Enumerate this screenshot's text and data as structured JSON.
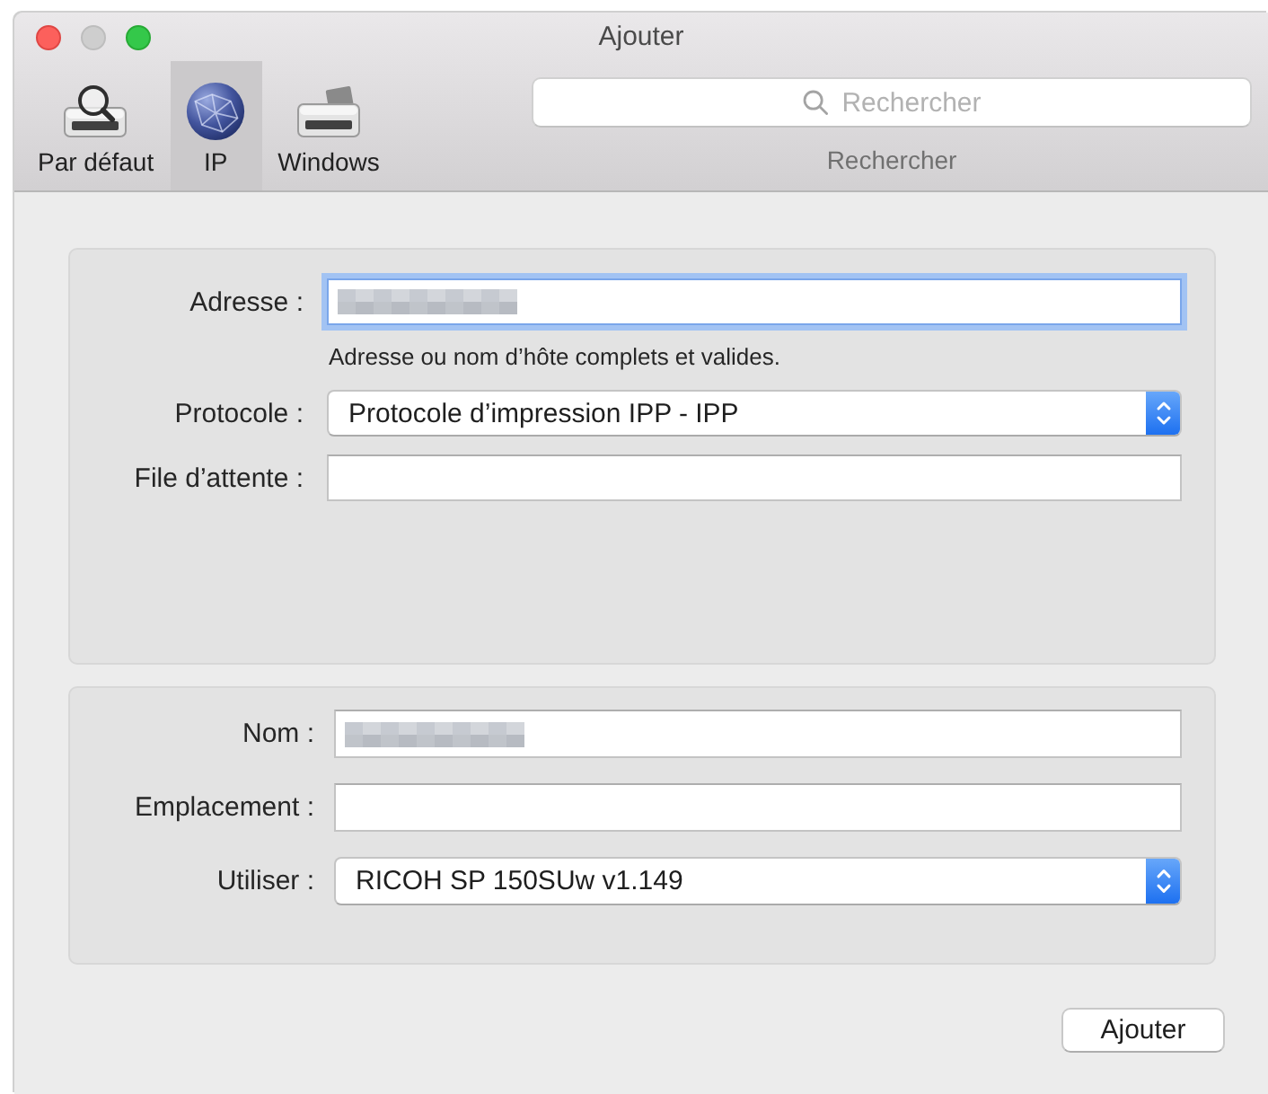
{
  "window": {
    "title": "Ajouter",
    "controls": [
      {
        "kind": "close",
        "disabled": false
      },
      {
        "kind": "minimize",
        "disabled": true
      },
      {
        "kind": "zoom",
        "disabled": false
      }
    ]
  },
  "toolbar": {
    "items": [
      {
        "kind": "default",
        "label": "Par défaut",
        "selected": false
      },
      {
        "kind": "ip",
        "label": "IP",
        "selected": true
      },
      {
        "kind": "windows",
        "label": "Windows",
        "selected": false
      }
    ],
    "search": {
      "placeholder": "Rechercher",
      "label": "Rechercher"
    }
  },
  "panels": [
    {
      "rows": [
        {
          "kind": "text",
          "label": "Adresse :",
          "focused": true,
          "redacted": true,
          "hint": "Adresse ou nom d’hôte complets et valides."
        },
        {
          "kind": "popup",
          "label": "Protocole :",
          "value": "Protocole d’impression IPP - IPP",
          "focused": false
        },
        {
          "kind": "text",
          "label": "File d’attente :",
          "focused": false,
          "redacted": false
        }
      ]
    },
    {
      "rows": [
        {
          "kind": "text",
          "label": "Nom :",
          "focused": false,
          "redacted": true
        },
        {
          "kind": "text",
          "label": "Emplacement :",
          "focused": false,
          "redacted": false
        },
        {
          "kind": "popup",
          "label": "Utiliser :",
          "value": "RICOH SP 150SUw v1.149",
          "focused": false
        }
      ]
    }
  ],
  "buttons": [
    {
      "label": "Ajouter"
    }
  ]
}
